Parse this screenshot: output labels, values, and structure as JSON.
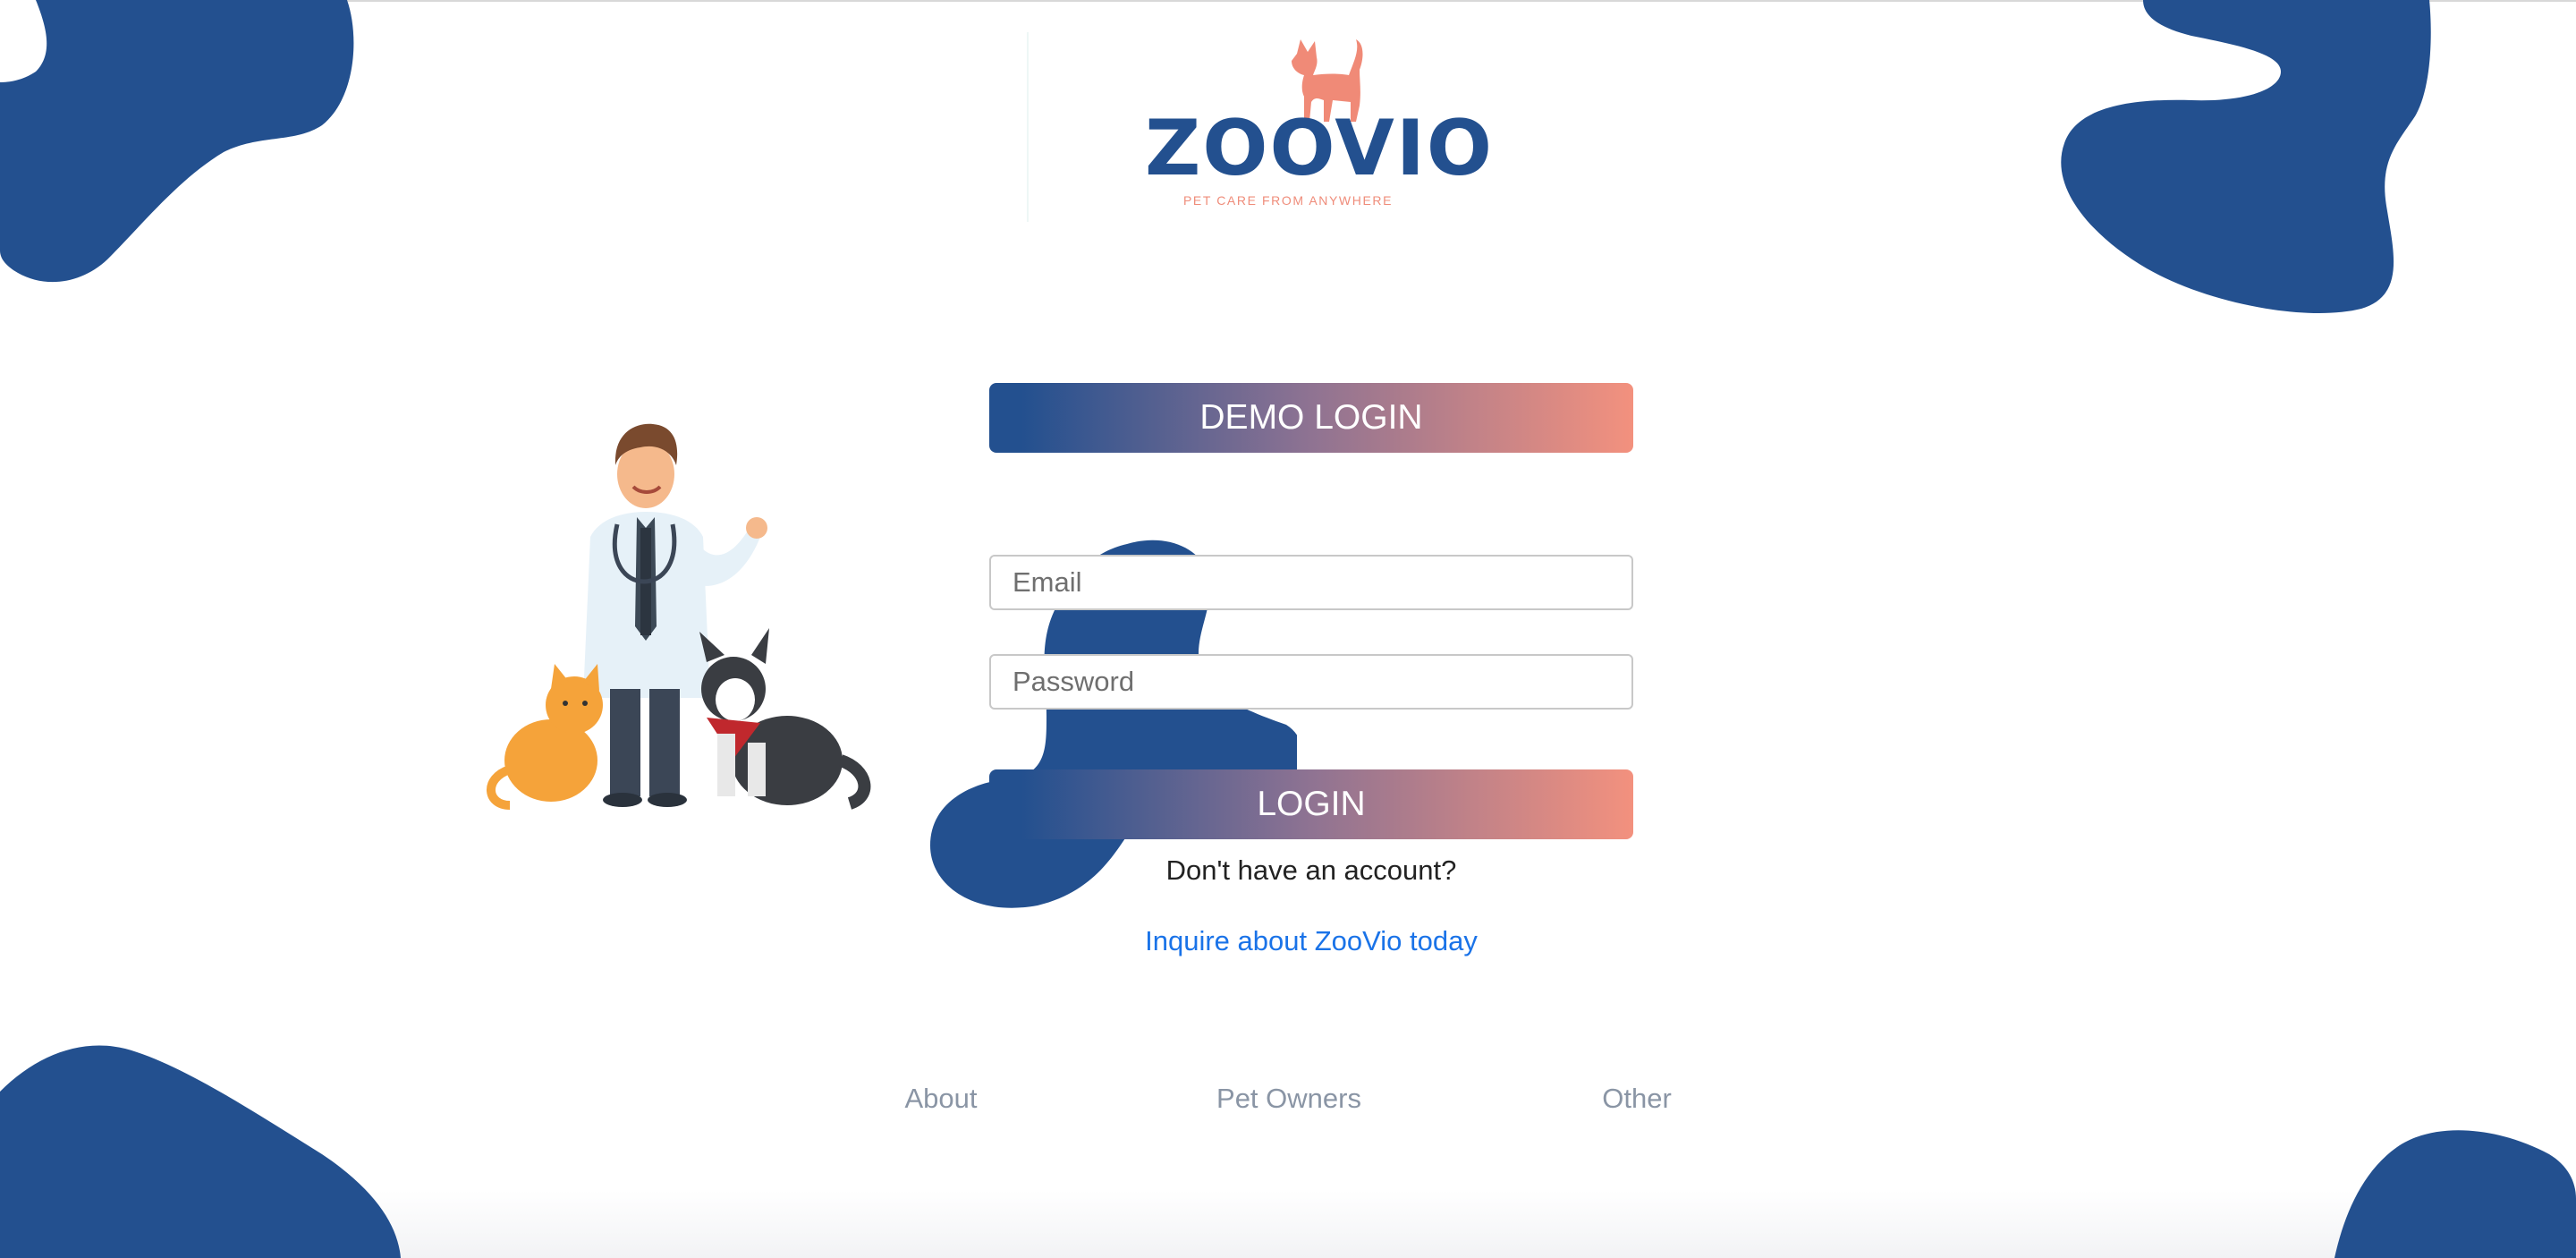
{
  "brand": {
    "name": "ZOOVIO",
    "tagline": "PET CARE FROM ANYWHERE",
    "logo_icon": "cat-icon",
    "primary_color": "#23508f",
    "accent_color": "#f3917e"
  },
  "hero": {
    "illustration": "vet-with-pets-illustration"
  },
  "login": {
    "demo_button": "DEMO LOGIN",
    "email_placeholder": "Email",
    "password_placeholder": "Password",
    "login_button": "LOGIN",
    "no_account_text": "Don't have an account?",
    "inquire_link": "Inquire about ZooVio today"
  },
  "footer": {
    "links": [
      "About",
      "Pet Owners",
      "Other"
    ]
  }
}
